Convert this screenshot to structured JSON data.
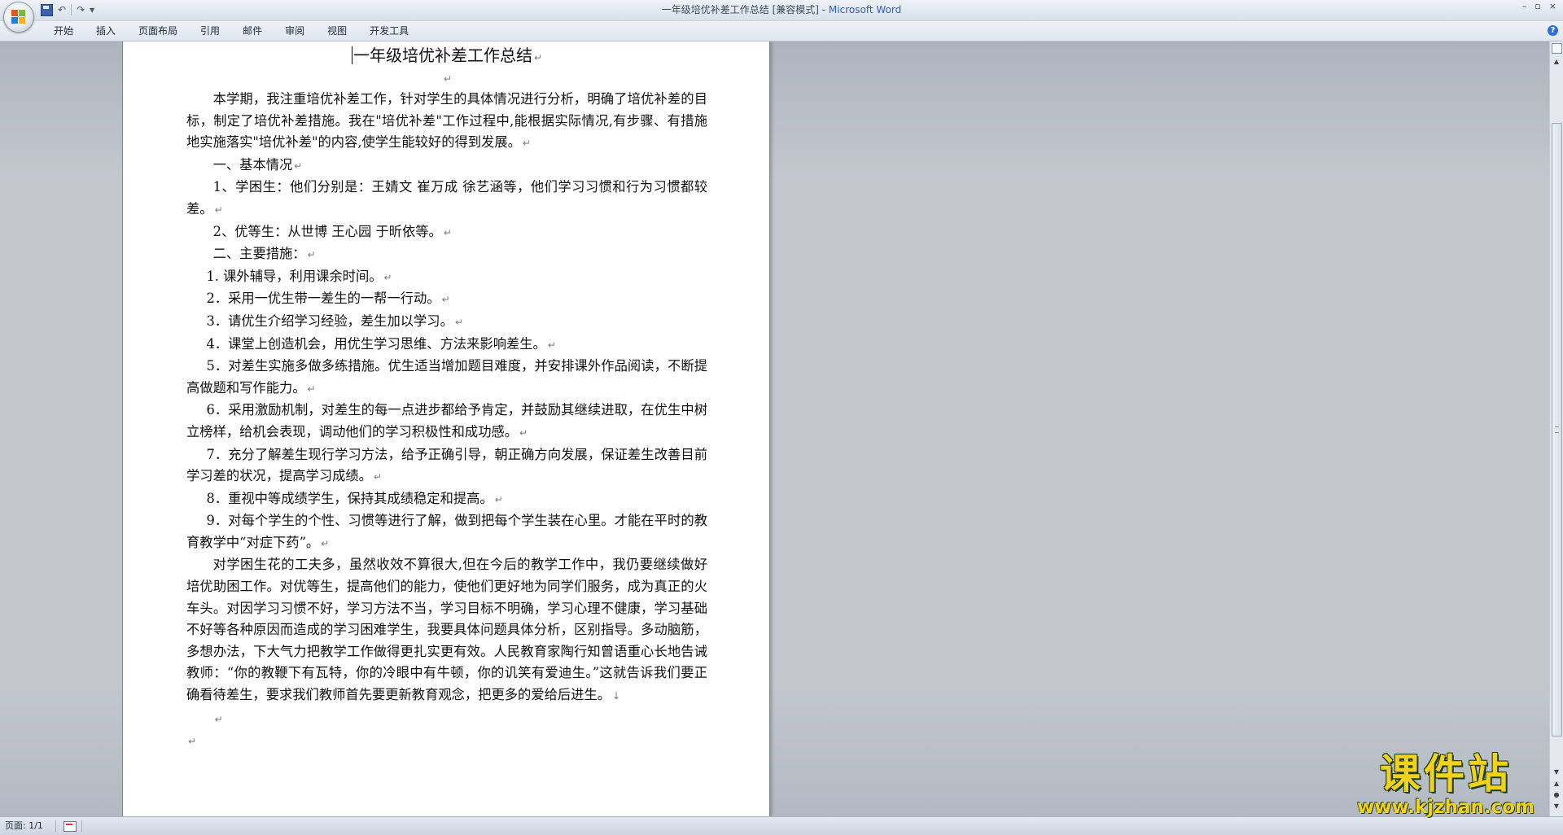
{
  "window": {
    "title": "一年级培优补差工作总结 [兼容模式] - ",
    "app_name": "Microsoft Word",
    "controls": [
      "–",
      "▫",
      "×"
    ]
  },
  "quick_access": {
    "undo_glyph": "↶",
    "redo_glyph": "↷",
    "more_glyph": "▾"
  },
  "ribbon": {
    "tabs": [
      "开始",
      "插入",
      "页面布局",
      "引用",
      "邮件",
      "审阅",
      "视图",
      "开发工具"
    ],
    "help": "?"
  },
  "document": {
    "title": "一年级培优补差工作总结",
    "paragraph_mark": "↵",
    "paragraphs": [
      "本学期，我注重培优补差工作，针对学生的具体情况进行分析，明确了培优补差的目标，制定了培优补差措施。我在\"培优补差\"工作过程中,能根据实际情况,有步骤、有措施地实施落实\"培优补差\"的内容,使学生能较好的得到发展。",
      "一、基本情况",
      "1、学困生：他们分别是：王婧文  崔万成  徐艺涵等，他们学习习惯和行为习惯都较差。",
      "2、优等生：从世博  王心园  于昕依等。",
      "二、主要措施：",
      "1. 课外辅导，利用课余时间。",
      "2．采用一优生带一差生的一帮一行动。",
      "3．请优生介绍学习经验，差生加以学习。",
      "4．课堂上创造机会，用优生学习思维、方法来影响差生。",
      "5．对差生实施多做多练措施。优生适当增加题目难度，并安排课外作品阅读，不断提高做题和写作能力。",
      "6．采用激励机制，对差生的每一点进步都给予肯定，并鼓励其继续进取，在优生中树立榜样，给机会表现，调动他们的学习积极性和成功感。",
      "7．充分了解差生现行学习方法，给予正确引导，朝正确方向发展，保证差生改善目前学习差的状况，提高学习成绩。",
      "8．重视中等成绩学生，保持其成绩稳定和提高。",
      "9．对每个学生的个性、习惯等进行了解，做到把每个学生装在心里。才能在平时的教育教学中“对症下药”。",
      "对学困生花的工夫多，虽然收效不算很大,但在今后的教学工作中，我仍要继续做好培优助困工作。对优等生，提高他们的能力，使他们更好地为同学们服务，成为真正的火车头。对因学习习惯不好，学习方法不当，学习目标不明确，学习心理不健康，学习基础不好等各种原因而造成的学习困难学生，我要具体问题具体分析，区别指导。多动脑筋，多想办法，下大气力把教学工作做得更扎实更有效。人民教育家陶行知曾语重心长地告诫教师：“你的教鞭下有瓦特，你的冷眼中有牛顿，你的讥笑有爱迪生。”这就告诉我们要正确看待差生，要求我们教师首先要更新教育观念，把更多的爱给后进生。"
    ],
    "manual_break_mark": "↓"
  },
  "statusbar": {
    "page_info": "页面: 1/1"
  },
  "watermark": {
    "main": "课件站",
    "url": "www.kjzhan.com"
  },
  "colors": {
    "workspace_bg": "#c3c8cf",
    "app_name_blue": "#2f5fb3",
    "watermark_yellow": "#f2d21a"
  }
}
